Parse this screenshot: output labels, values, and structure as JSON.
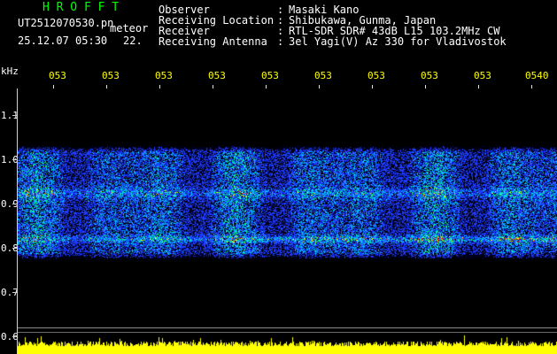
{
  "header": {
    "app_title": "H R O F F T",
    "filename": "UT2512070530.pn",
    "filename_suffix": "meteor",
    "date_time": "25.12.07 05:30",
    "counter": "22.",
    "fields": [
      {
        "label": "Observer",
        "sep": ":",
        "value": "Masaki Kano"
      },
      {
        "label": "Receiving Location",
        "sep": ":",
        "value": "Shibukawa, Gunma, Japan"
      },
      {
        "label": "Receiver",
        "sep": ":",
        "value": "RTL-SDR SDR# 43dB L15 103.2MHz CW"
      },
      {
        "label": "Receiving Antenna",
        "sep": ":",
        "value": "3el Yagi(V) Az 330 for Vladivostok"
      }
    ]
  },
  "axis": {
    "y_unit": "kHz",
    "y_ticks": [
      "1.1",
      "1.0",
      "0.9",
      "0.8",
      "0.7",
      "0.6"
    ],
    "x_ticks": [
      "053",
      "053",
      "053",
      "053",
      "053",
      "053",
      "053",
      "053",
      "053",
      "0540"
    ]
  },
  "colors": {
    "background": "#000000",
    "title_green": "#00ff00",
    "tick_yellow": "#ffff00",
    "signal_blue": "#1e3cff",
    "signal_cyan": "#00c8ff",
    "signal_green": "#00ff80",
    "signal_yellow": "#ffff00",
    "signal_red": "#ff2000",
    "level_bar": "#ffff00"
  }
}
